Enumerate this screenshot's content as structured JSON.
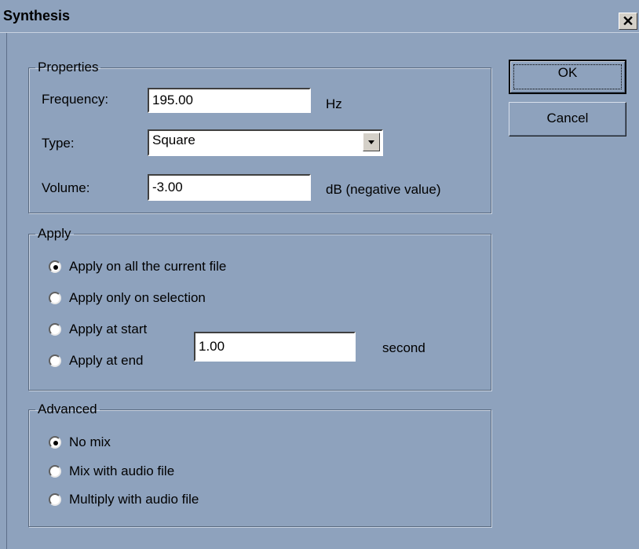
{
  "window": {
    "title": "Synthesis",
    "close_glyph": "✕"
  },
  "properties": {
    "legend": "Properties",
    "frequency_label": "Frequency:",
    "frequency_value": "195.00",
    "frequency_unit": "Hz",
    "type_label": "Type:",
    "type_value": "Square",
    "volume_label": "Volume:",
    "volume_value": "-3.00",
    "volume_unit": "dB (negative value)"
  },
  "apply": {
    "legend": "Apply",
    "options": [
      {
        "label": "Apply on all the current file",
        "selected": true
      },
      {
        "label": "Apply only on selection",
        "selected": false
      },
      {
        "label": "Apply at start",
        "selected": false
      },
      {
        "label": "Apply at end",
        "selected": false
      }
    ],
    "duration_value": "1.00",
    "duration_unit": "second"
  },
  "advanced": {
    "legend": "Advanced",
    "options": [
      {
        "label": "No mix",
        "selected": true
      },
      {
        "label": "Mix with audio file",
        "selected": false
      },
      {
        "label": "Multiply with audio file",
        "selected": false
      }
    ]
  },
  "buttons": {
    "ok": "OK",
    "cancel": "Cancel"
  },
  "colors": {
    "background": "#8ea2bd",
    "input_bg": "#ffffff"
  }
}
